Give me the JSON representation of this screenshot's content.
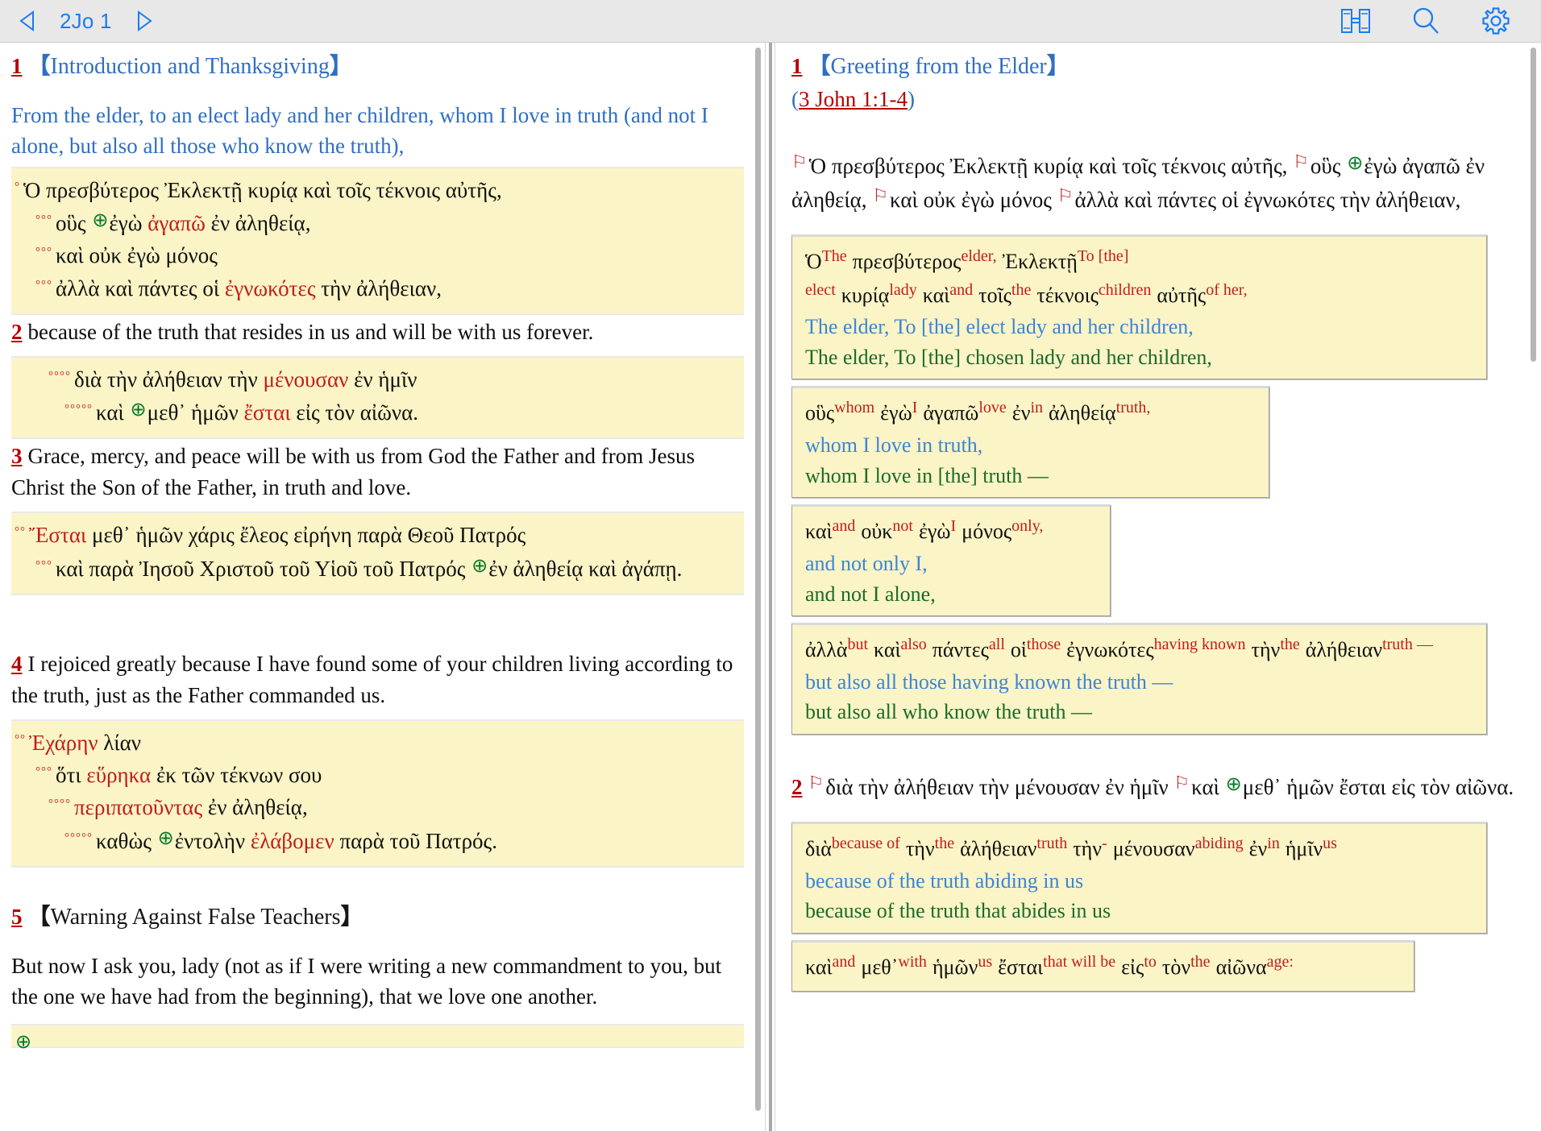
{
  "toolbar": {
    "prev_icon": "triangle-left-icon",
    "next_icon": "triangle-right-icon",
    "reference": "2Jo 1",
    "parallel_icon": "parallel-view-icon",
    "search_icon": "search-icon",
    "settings_icon": "gear-icon"
  },
  "left_pane": {
    "section": {
      "number": "1",
      "open_bracket": "【",
      "title": "Introduction and Thanksgiving",
      "close_bracket": "】"
    },
    "v1_english": "From the elder, to an elect lady and her children, whom I love in truth (and not I alone, but also all those who know the truth),",
    "v1_greek": [
      {
        "indent": 0,
        "dots": "°",
        "parts": [
          {
            "t": "Ὁ πρεσβύτερος Ἐκλεκτῇ κυρίᾳ καὶ τοῖς τέκνοις αὐτῆς,",
            "c": "black"
          }
        ]
      },
      {
        "indent": 1,
        "dots": "°°°",
        "parts": [
          {
            "t": "οὓς ",
            "c": "black"
          },
          {
            "t": "⊕",
            "c": "cross"
          },
          {
            "t": "ἐγὼ ",
            "c": "black"
          },
          {
            "t": "ἀγαπῶ",
            "c": "red"
          },
          {
            "t": " ἐν ἀληθείᾳ,",
            "c": "black"
          }
        ]
      },
      {
        "indent": 1,
        "dots": "°°°",
        "parts": [
          {
            "t": "καὶ οὐκ ἐγὼ μόνος",
            "c": "black"
          }
        ]
      },
      {
        "indent": 1,
        "dots": "°°°",
        "parts": [
          {
            "t": "ἀλλὰ καὶ πάντες οἱ ",
            "c": "black"
          },
          {
            "t": "ἐγνωκότες",
            "c": "red"
          },
          {
            "t": " τὴν ἀλήθειαν,",
            "c": "black"
          }
        ]
      }
    ],
    "v2_number": "2",
    "v2_english": "because of the truth that resides in us and will be with us forever.",
    "v2_greek": [
      {
        "indent": 2,
        "dots": "°°°°",
        "parts": [
          {
            "t": "διὰ τὴν ἀλήθειαν τὴν ",
            "c": "black"
          },
          {
            "t": "μένουσαν",
            "c": "red"
          },
          {
            "t": " ἐν ἡμῖν",
            "c": "black"
          }
        ]
      },
      {
        "indent": 3,
        "dots": "°°°°°",
        "parts": [
          {
            "t": "καὶ ",
            "c": "black"
          },
          {
            "t": "⊕",
            "c": "cross"
          },
          {
            "t": "μεθ᾽ ἡμῶν ",
            "c": "black"
          },
          {
            "t": "ἔσται",
            "c": "red"
          },
          {
            "t": " εἰς τὸν αἰῶνα.",
            "c": "black"
          }
        ]
      }
    ],
    "v3_number": "3",
    "v3_english": "Grace, mercy, and peace will be with us from God the Father and from Jesus Christ the Son of the Father, in truth and love.",
    "v3_greek": [
      {
        "indent": 0,
        "dots": "°°",
        "parts": [
          {
            "t": "Ἔσται",
            "c": "red"
          },
          {
            "t": " μεθ᾽ ἡμῶν χάρις ἔλεος εἰρήνη παρὰ Θεοῦ Πατρός",
            "c": "black"
          }
        ]
      },
      {
        "indent": 1,
        "dots": "°°°",
        "wrap": true,
        "parts": [
          {
            "t": "καὶ παρὰ Ἰησοῦ Χριστοῦ τοῦ Υἱοῦ τοῦ Πατρός ",
            "c": "black"
          },
          {
            "t": "⊕",
            "c": "cross"
          },
          {
            "t": "ἐν ἀληθείᾳ καὶ ἀγάπῃ.",
            "c": "black"
          }
        ]
      }
    ],
    "v4_number": "4",
    "v4_english": "I rejoiced greatly because I have found some of your children living according to the truth, just as the Father commanded us.",
    "v4_greek": [
      {
        "indent": 0,
        "dots": "°°",
        "parts": [
          {
            "t": "Ἐχάρην",
            "c": "red"
          },
          {
            "t": " λίαν",
            "c": "black"
          }
        ]
      },
      {
        "indent": 1,
        "dots": "°°°",
        "parts": [
          {
            "t": "ὅτι ",
            "c": "black"
          },
          {
            "t": "εὕρηκα",
            "c": "red"
          },
          {
            "t": " ἐκ τῶν τέκνων σου",
            "c": "black"
          }
        ]
      },
      {
        "indent": 2,
        "dots": "°°°°",
        "parts": [
          {
            "t": "περιπατοῦντας",
            "c": "red"
          },
          {
            "t": " ἐν ἀληθείᾳ,",
            "c": "black"
          }
        ]
      },
      {
        "indent": 3,
        "dots": "°°°°°",
        "parts": [
          {
            "t": "καθὼς ",
            "c": "black"
          },
          {
            "t": "⊕",
            "c": "cross"
          },
          {
            "t": "ἐντολὴν ",
            "c": "black"
          },
          {
            "t": "ἐλάβομεν",
            "c": "red"
          },
          {
            "t": " παρὰ τοῦ Πατρός.",
            "c": "black"
          }
        ]
      }
    ],
    "section2": {
      "number": "5",
      "open_bracket": "【",
      "title": "Warning Against False Teachers",
      "close_bracket": "】"
    },
    "v5_english": "But now I ask you, lady (not as if I were writing a new commandment to you, but the one we have had from the beginning), that we love one another."
  },
  "right_pane": {
    "section": {
      "number": "1",
      "open_bracket": "【",
      "title": "Greeting from the Elder",
      "close_bracket": "】"
    },
    "cross_ref": {
      "open": "(",
      "link": "3 John 1:1-4",
      "close": ")"
    },
    "v1_flow": [
      {
        "t": "⚐",
        "c": "flag"
      },
      {
        "t": "Ὁ πρεσβύτερος Ἐκλεκτῇ κυρίᾳ καὶ τοῖς τέκνοις αὐτῆς, ",
        "c": "black"
      },
      {
        "t": "⚐",
        "c": "flag"
      },
      {
        "t": "οὓς ",
        "c": "black"
      },
      {
        "t": "⊕",
        "c": "cross"
      },
      {
        "t": "ἐγὼ ἀγαπῶ ἐν ἀληθείᾳ, ",
        "c": "black"
      },
      {
        "t": "⚐",
        "c": "flag"
      },
      {
        "t": "καὶ οὐκ ἐγὼ μόνος ",
        "c": "black"
      },
      {
        "t": "⚐",
        "c": "flag"
      },
      {
        "t": "ἀλλὰ καὶ πάντες οἱ ἐγνωκότες τὴν ἀλήθειαν,",
        "c": "black"
      }
    ],
    "cards": [
      {
        "pairs": [
          {
            "gk": "Ὁ",
            "gl": "The"
          },
          {
            "gk": "πρεσβύτερος",
            "gl": "elder,"
          },
          {
            "gk": "Ἐκλεκτῇ",
            "gl": "To [the] elect"
          },
          {
            "gk": "κυρίᾳ",
            "gl": "lady"
          },
          {
            "gk": "καὶ",
            "gl": "and"
          },
          {
            "gk": "τοῖς",
            "gl": "the"
          },
          {
            "gk": "τέκνοις",
            "gl": "children"
          },
          {
            "gk": "αὐτῆς",
            "gl": "of her,"
          }
        ],
        "blue": "The elder, To [the] elect lady and her children,",
        "green": "The elder, To [the] chosen lady and her children,",
        "width": "full"
      },
      {
        "pairs": [
          {
            "gk": "οὓς",
            "gl": "whom"
          },
          {
            "gk": "ἐγὼ",
            "gl": "I"
          },
          {
            "gk": "ἀγαπῶ",
            "gl": "love"
          },
          {
            "gk": "ἐν",
            "gl": "in"
          },
          {
            "gk": "ἀληθείᾳ",
            "gl": "truth,"
          }
        ],
        "blue": "whom I love in truth,",
        "green": "whom I love in [the] truth —",
        "width": "med"
      },
      {
        "pairs": [
          {
            "gk": "καὶ",
            "gl": "and"
          },
          {
            "gk": "οὐκ",
            "gl": "not"
          },
          {
            "gk": "ἐγὼ",
            "gl": "I"
          },
          {
            "gk": "μόνος",
            "gl": "only,"
          }
        ],
        "blue": "and not only I,",
        "green": "and not I alone,",
        "width": "small"
      },
      {
        "pairs": [
          {
            "gk": "ἀλλὰ",
            "gl": "but"
          },
          {
            "gk": "καὶ",
            "gl": "also"
          },
          {
            "gk": "πάντες",
            "gl": "all"
          },
          {
            "gk": "οἱ",
            "gl": "those"
          },
          {
            "gk": "ἐγνωκότες",
            "gl": "having known"
          },
          {
            "gk": "τὴν",
            "gl": "the"
          },
          {
            "gk": "ἀλήθειαν",
            "gl": "truth —"
          }
        ],
        "blue": "but also all those having known the truth —",
        "green": "but also all who know the truth —",
        "width": "full"
      }
    ],
    "v2_number": "2",
    "v2_flow": [
      {
        "t": "⚐",
        "c": "flag"
      },
      {
        "t": "διὰ τὴν ἀλήθειαν τὴν μένουσαν ἐν ἡμῖν ",
        "c": "black"
      },
      {
        "t": "⚐",
        "c": "flag"
      },
      {
        "t": "καὶ ",
        "c": "black"
      },
      {
        "t": "⊕",
        "c": "cross"
      },
      {
        "t": "μεθ᾽ ἡμῶν ἔσται εἰς τὸν αἰῶνα.",
        "c": "black"
      }
    ],
    "cards2": [
      {
        "pairs": [
          {
            "gk": "διὰ",
            "gl": "because of"
          },
          {
            "gk": "τὴν",
            "gl": "the"
          },
          {
            "gk": "ἀλήθειαν",
            "gl": "truth"
          },
          {
            "gk": "τὴν",
            "gl": "-"
          },
          {
            "gk": "μένουσαν",
            "gl": "abiding"
          },
          {
            "gk": "ἐν",
            "gl": "in"
          },
          {
            "gk": "ἡμῖν",
            "gl": "us"
          }
        ],
        "blue": "because of the truth abiding in us",
        "green": "because of the truth that abides in us",
        "width": "full"
      },
      {
        "pairs": [
          {
            "gk": "καὶ",
            "gl": "and"
          },
          {
            "gk": "μεθ᾽",
            "gl": "with"
          },
          {
            "gk": "ἡμῶν",
            "gl": "us"
          },
          {
            "gk": "ἔσται",
            "gl": "that will be"
          },
          {
            "gk": "εἰς",
            "gl": "to"
          },
          {
            "gk": "τὸν",
            "gl": "the"
          },
          {
            "gk": "αἰῶνα",
            "gl": "age:"
          }
        ],
        "blue": "",
        "green": "",
        "width": "wide"
      }
    ]
  },
  "colors": {
    "toolbar_bg": "#e8e8e8",
    "accent_blue": "#1a7cf0",
    "verse_red": "#b40000",
    "greek_highlight": "#fbf4c6",
    "gloss_red": "#c21c1c",
    "translation_blue": "#3a86d6",
    "translation_green": "#1b6b2a",
    "cross_green": "#0b7a2a"
  }
}
